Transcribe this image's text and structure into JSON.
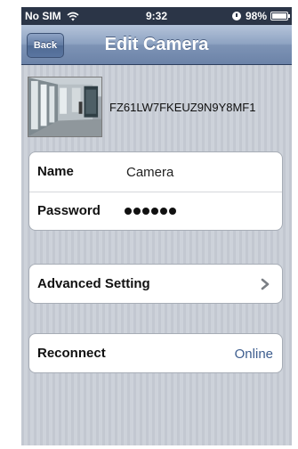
{
  "status_bar": {
    "carrier": "No SIM",
    "time": "9:32",
    "battery": "98%",
    "battery_level": 0.98
  },
  "nav": {
    "back_label": "Back",
    "title": "Edit Camera"
  },
  "camera": {
    "id": "FZ61LW7FKEUZ9N9Y8MF1",
    "thumbnail": "camera-snapshot-thumbnail"
  },
  "fields": {
    "name_label": "Name",
    "name_value": "Camera",
    "password_label": "Password",
    "password_length": 6
  },
  "advanced": {
    "label": "Advanced Setting",
    "icon": "chevron-right-icon"
  },
  "reconnect": {
    "label": "Reconnect",
    "status": "Online"
  },
  "colors": {
    "nav_bar": "#7d93b5",
    "status_bar": "#2b3547",
    "status_online": "#3e5e8f",
    "background": "#c8cdd5"
  }
}
